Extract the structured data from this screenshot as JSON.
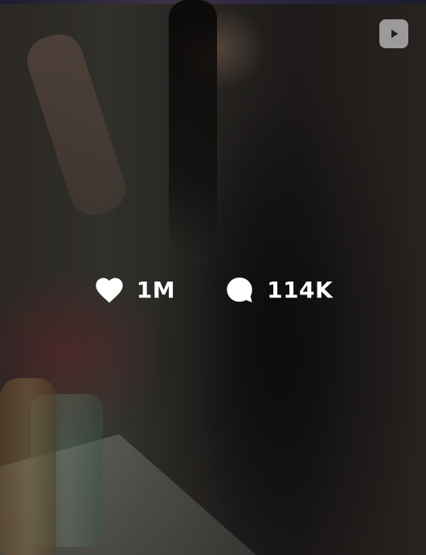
{
  "post": {
    "media_type_icon": "video-play-icon",
    "stats": {
      "likes": {
        "icon": "heart-icon",
        "value": "1M"
      },
      "comments": {
        "icon": "comment-bubble-icon",
        "value": "114K"
      }
    }
  },
  "colors": {
    "overlay_text": "#ffffff",
    "badge_bg": "rgba(255,255,255,0.55)"
  }
}
